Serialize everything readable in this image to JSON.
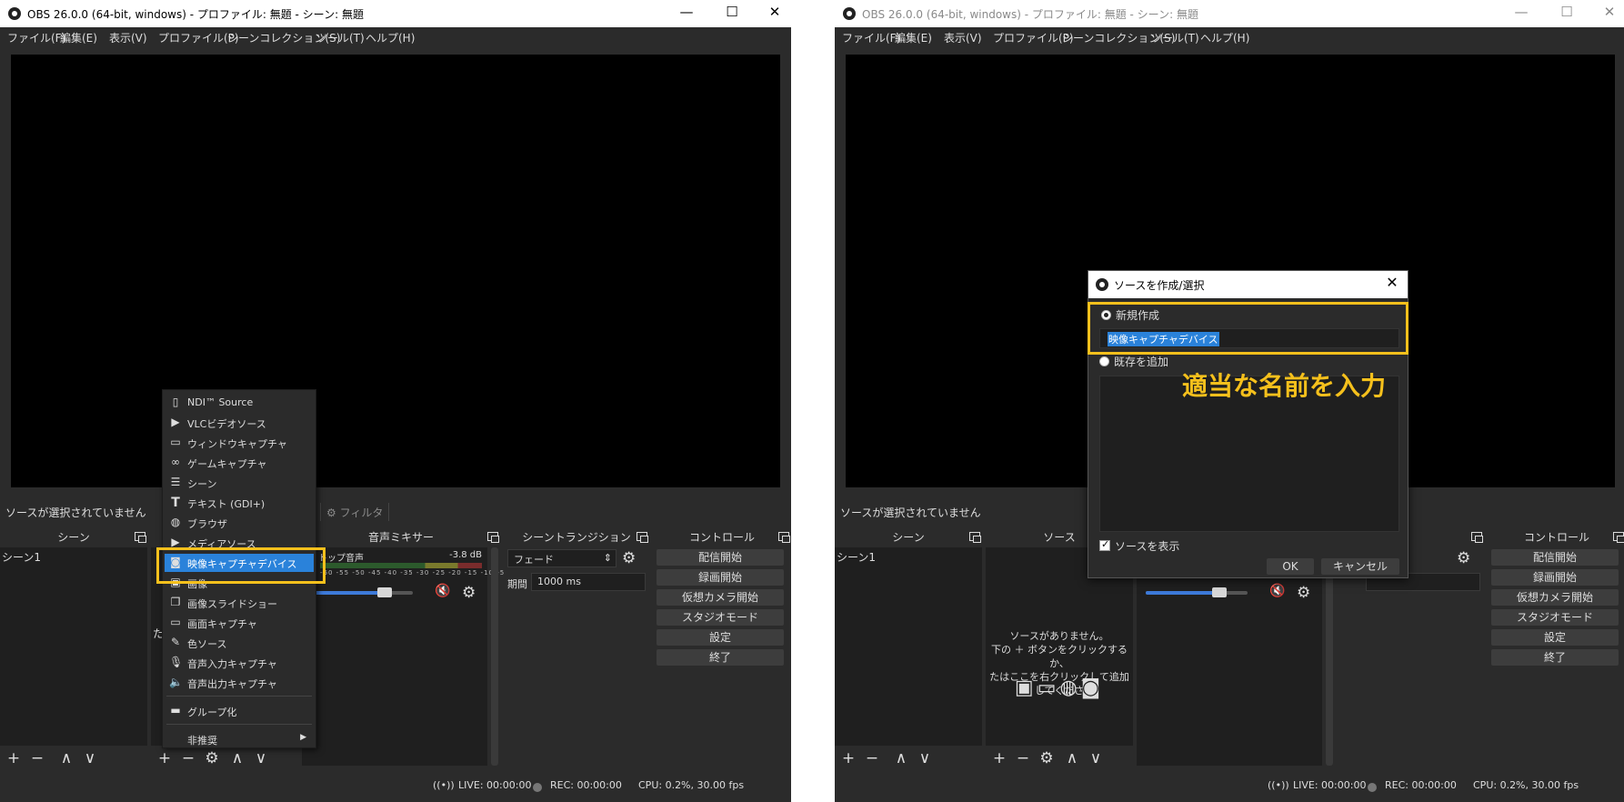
{
  "window": {
    "title": "OBS 26.0.0 (64-bit, windows) - プロファイル: 無題 - シーン: 無題",
    "minimize": "—",
    "maximize": "☐",
    "close": "✕"
  },
  "menu": [
    "ファイル(F)",
    "編集(E)",
    "表示(V)",
    "プロファイル(P)",
    "シーンコレクション(S)",
    "ツール(T)",
    "ヘルプ(H)"
  ],
  "source_bar": {
    "no_source": "ソースが選択されていません",
    "filters": "フィルタ"
  },
  "docks": {
    "scenes": "シーン",
    "sources": "ソース",
    "mixer": "音声ミキサー",
    "transitions": "シーントランジション",
    "controls": "コントロール"
  },
  "scene_list": [
    "シーン1"
  ],
  "sources_empty": {
    "line1": "ソースがありません。",
    "line2": "下の ＋ ボタンをクリックするか、",
    "line3": "たはここを右クリックして追加してくださ",
    "partial": "た"
  },
  "mixer": {
    "item": "デスクトップ音声",
    "item_left": "トップ音声",
    "db": "-3.8 dB",
    "scale": "-60 -55 -50 -45 -40 -35 -30 -25 -20 -15 -10 -5 0",
    "volume_level": 0.72
  },
  "transition": {
    "type": "フェード",
    "duration_label": "期間",
    "duration": "1000 ms"
  },
  "controls": [
    "配信開始",
    "録画開始",
    "仮想カメラ開始",
    "スタジオモード",
    "設定",
    "終了"
  ],
  "status": {
    "live": "LIVE: 00:00:00",
    "rec": "REC: 00:00:00",
    "cpu": "CPU: 0.2%, 30.00 fps"
  },
  "context_menu": {
    "items": [
      {
        "label": "NDI™ Source",
        "icon": "page-icon"
      },
      {
        "label": "VLCビデオソース",
        "icon": "play-icon"
      },
      {
        "label": "ウィンドウキャプチャ",
        "icon": "window-icon"
      },
      {
        "label": "ゲームキャプチャ",
        "icon": "gamepad-icon"
      },
      {
        "label": "シーン",
        "icon": "list-icon"
      },
      {
        "label": "テキスト (GDI+)",
        "icon": "text-icon"
      },
      {
        "label": "ブラウザ",
        "icon": "globe-icon"
      },
      {
        "label": "メディアソース",
        "icon": "play-icon"
      },
      {
        "label": "映像キャプチャデバイス",
        "icon": "camera-icon"
      },
      {
        "label": "画像",
        "icon": "image-icon"
      },
      {
        "label": "画像スライドショー",
        "icon": "slideshow-icon"
      },
      {
        "label": "画面キャプチャ",
        "icon": "monitor-icon"
      },
      {
        "label": "色ソース",
        "icon": "brush-icon"
      },
      {
        "label": "音声入力キャプチャ",
        "icon": "mic-icon"
      },
      {
        "label": "音声出力キャプチャ",
        "icon": "speaker-icon"
      }
    ],
    "group": "グループ化",
    "deprecated": "非推奨",
    "selected_index": 8
  },
  "dialog": {
    "title": "ソースを作成/選択",
    "create_new": "新規作成",
    "name_value": "映像キャプチャデバイス",
    "add_existing": "既存を追加",
    "show_source": "ソースを表示",
    "ok": "OK",
    "cancel": "キャンセル"
  },
  "annotation": "適当な名前を入力",
  "colors": {
    "highlight": "#f5c01c",
    "selection": "#2a82da",
    "panel": "#2b2b2b",
    "preview": "#000000"
  }
}
